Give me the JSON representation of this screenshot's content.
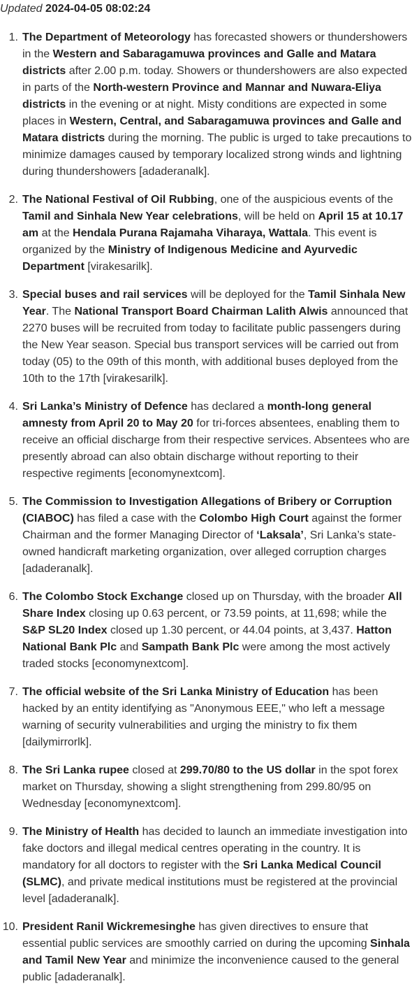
{
  "header": {
    "label": "Updated",
    "timestamp": "2024-04-05 08:02:24"
  },
  "items": [
    {
      "number": "1.",
      "segments": [
        {
          "text": "The Department of Meteorology",
          "bold": true
        },
        {
          "text": " has forecasted showers or thundershowers in the ",
          "bold": false
        },
        {
          "text": "Western and Sabaragamuwa provinces and Galle and Matara districts",
          "bold": true
        },
        {
          "text": " after 2.00 p.m. today. Showers or thundershowers are also expected in parts of the ",
          "bold": false
        },
        {
          "text": "North-western Province and Mannar and Nuwara-Eliya districts",
          "bold": true
        },
        {
          "text": " in the evening or at night. Misty conditions are expected in some places in ",
          "bold": false
        },
        {
          "text": "Western, Central, and Sabaragamuwa provinces and Galle and Matara districts",
          "bold": true
        },
        {
          "text": " during the morning. The public is urged to take precautions to minimize damages caused by temporary localized strong winds and lightning during thundershowers [adaderanalk].",
          "bold": false
        }
      ]
    },
    {
      "number": "2.",
      "segments": [
        {
          "text": "The National Festival of Oil Rubbing",
          "bold": true
        },
        {
          "text": ", one of the auspicious events of the ",
          "bold": false
        },
        {
          "text": "Tamil and Sinhala New Year celebrations",
          "bold": true
        },
        {
          "text": ", will be held on ",
          "bold": false
        },
        {
          "text": "April 15 at 10.17 am",
          "bold": true
        },
        {
          "text": " at the ",
          "bold": false
        },
        {
          "text": "Hendala Purana Rajamaha Viharaya, Wattala",
          "bold": true
        },
        {
          "text": ". This event is organized by the ",
          "bold": false
        },
        {
          "text": "Ministry of Indigenous Medicine and Ayurvedic Department",
          "bold": true
        },
        {
          "text": " [virakesarilk].",
          "bold": false
        }
      ]
    },
    {
      "number": "3.",
      "segments": [
        {
          "text": "Special buses and rail services",
          "bold": true
        },
        {
          "text": " will be deployed for the ",
          "bold": false
        },
        {
          "text": "Tamil Sinhala New Year",
          "bold": true
        },
        {
          "text": ". The ",
          "bold": false
        },
        {
          "text": "National Transport Board Chairman Lalith Alwis",
          "bold": true
        },
        {
          "text": " announced that 2270 buses will be recruited from today to facilitate public passengers during the New Year season. Special bus transport services will be carried out from today (05) to the 09th of this month, with additional buses deployed from the 10th to the 17th [virakesarilk].",
          "bold": false
        }
      ]
    },
    {
      "number": "4.",
      "segments": [
        {
          "text": "Sri Lanka’s Ministry of Defence",
          "bold": true
        },
        {
          "text": " has declared a ",
          "bold": false
        },
        {
          "text": "month-long general amnesty from April 20 to May 20",
          "bold": true
        },
        {
          "text": " for tri-forces absentees, enabling them to receive an official discharge from their respective services. Absentees who are presently abroad can also obtain discharge without reporting to their respective regiments [economynextcom].",
          "bold": false
        }
      ]
    },
    {
      "number": "5.",
      "segments": [
        {
          "text": "The Commission to Investigation Allegations of Bribery or Corruption (CIABOC)",
          "bold": true
        },
        {
          "text": " has filed a case with the ",
          "bold": false
        },
        {
          "text": "Colombo High Court",
          "bold": true
        },
        {
          "text": " against the former Chairman and the former Managing Director of ",
          "bold": false
        },
        {
          "text": "‘Laksala’",
          "bold": true
        },
        {
          "text": ", Sri Lanka’s state-owned handicraft marketing organization, over alleged corruption charges [adaderanalk].",
          "bold": false
        }
      ]
    },
    {
      "number": "6.",
      "segments": [
        {
          "text": "The Colombo Stock Exchange",
          "bold": true
        },
        {
          "text": " closed up on Thursday, with the broader ",
          "bold": false
        },
        {
          "text": "All Share Index",
          "bold": true
        },
        {
          "text": " closing up 0.63 percent, or 73.59 points, at 11,698; while the ",
          "bold": false
        },
        {
          "text": "S&P SL20 Index",
          "bold": true
        },
        {
          "text": " closed up 1.30 percent, or 44.04 points, at 3,437. ",
          "bold": false
        },
        {
          "text": "Hatton National Bank Plc",
          "bold": true
        },
        {
          "text": " and ",
          "bold": false
        },
        {
          "text": "Sampath Bank Plc",
          "bold": true
        },
        {
          "text": " were among the most actively traded stocks [economynextcom].",
          "bold": false
        }
      ]
    },
    {
      "number": "7.",
      "segments": [
        {
          "text": "The official website of the Sri Lanka Ministry of Education",
          "bold": true
        },
        {
          "text": " has been hacked by an entity identifying as \"Anonymous EEE,\" who left a message warning of security vulnerabilities and urging the ministry to fix them [dailymirrorlk].",
          "bold": false
        }
      ]
    },
    {
      "number": "8.",
      "segments": [
        {
          "text": "The Sri Lanka rupee",
          "bold": true
        },
        {
          "text": " closed at ",
          "bold": false
        },
        {
          "text": "299.70/80 to the US dollar",
          "bold": true
        },
        {
          "text": " in the spot forex market on Thursday, showing a slight strengthening from 299.80/95 on Wednesday [economynextcom].",
          "bold": false
        }
      ]
    },
    {
      "number": "9.",
      "segments": [
        {
          "text": "The Ministry of Health",
          "bold": true
        },
        {
          "text": " has decided to launch an immediate investigation into fake doctors and illegal medical centres operating in the country. It is mandatory for all doctors to register with the ",
          "bold": false
        },
        {
          "text": "Sri Lanka Medical Council (SLMC)",
          "bold": true
        },
        {
          "text": ", and private medical institutions must be registered at the provincial level [adaderanalk].",
          "bold": false
        }
      ]
    },
    {
      "number": "10.",
      "segments": [
        {
          "text": "President Ranil Wickremesinghe",
          "bold": true
        },
        {
          "text": " has given directives to ensure that essential public services are smoothly carried on during the upcoming ",
          "bold": false
        },
        {
          "text": "Sinhala and Tamil New Year",
          "bold": true
        },
        {
          "text": " and minimize the inconvenience caused to the general public [adaderanalk].",
          "bold": false
        }
      ]
    }
  ]
}
